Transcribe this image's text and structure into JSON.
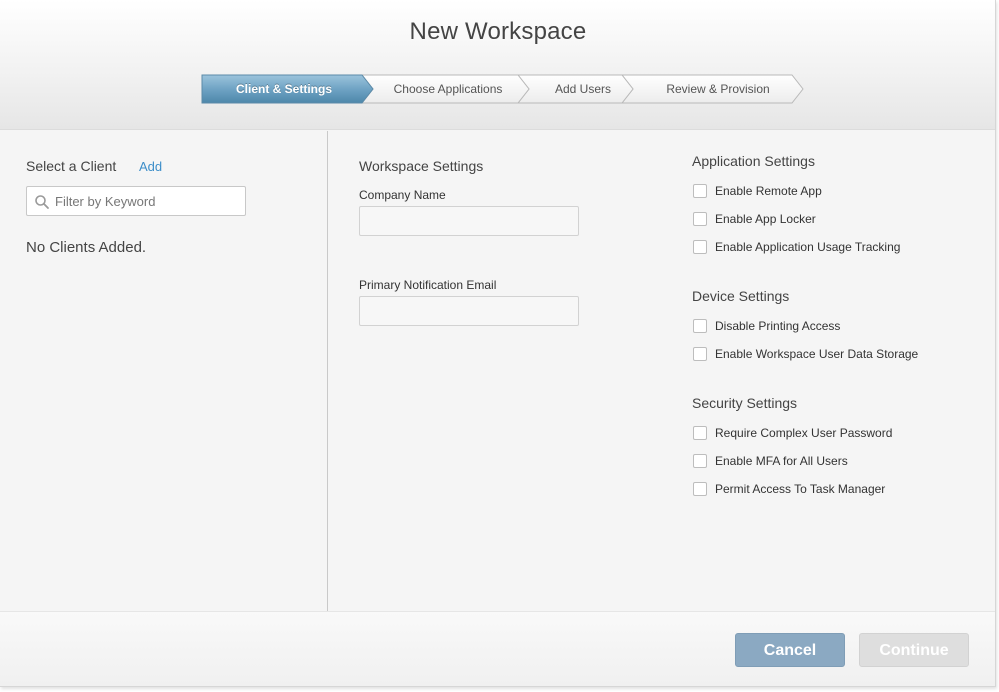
{
  "window": {
    "title": "New Workspace"
  },
  "wizard": {
    "steps": [
      {
        "label": "Client & Settings",
        "active": true
      },
      {
        "label": "Choose Applications",
        "active": false
      },
      {
        "label": "Add Users",
        "active": false
      },
      {
        "label": "Review & Provision",
        "active": false
      }
    ]
  },
  "client_panel": {
    "heading": "Select a Client",
    "add_link": "Add",
    "filter_placeholder": "Filter by Keyword",
    "filter_value": "",
    "empty_message": "No Clients Added."
  },
  "workspace_settings": {
    "heading": "Workspace Settings",
    "company_name": {
      "label": "Company Name",
      "value": ""
    },
    "notification_email": {
      "label": "Primary Notification Email",
      "value": ""
    }
  },
  "application_settings": {
    "heading": "Application Settings",
    "options": [
      {
        "label": "Enable Remote App",
        "checked": false
      },
      {
        "label": "Enable App Locker",
        "checked": false
      },
      {
        "label": "Enable Application Usage Tracking",
        "checked": false
      }
    ]
  },
  "device_settings": {
    "heading": "Device Settings",
    "options": [
      {
        "label": "Disable Printing Access",
        "checked": false
      },
      {
        "label": "Enable Workspace User Data Storage",
        "checked": false
      }
    ]
  },
  "security_settings": {
    "heading": "Security Settings",
    "options": [
      {
        "label": "Require Complex User Password",
        "checked": false
      },
      {
        "label": "Enable MFA for All Users",
        "checked": false
      },
      {
        "label": "Permit Access To Task Manager",
        "checked": false
      }
    ]
  },
  "footer": {
    "cancel_label": "Cancel",
    "continue_label": "Continue",
    "continue_enabled": false
  },
  "colors": {
    "accent_link": "#3d8ec9",
    "active_step_top": "#8fbbd6",
    "active_step_bottom": "#4d87aa",
    "cancel_button": "#8ba9c2",
    "continue_disabled": "#dedede"
  }
}
